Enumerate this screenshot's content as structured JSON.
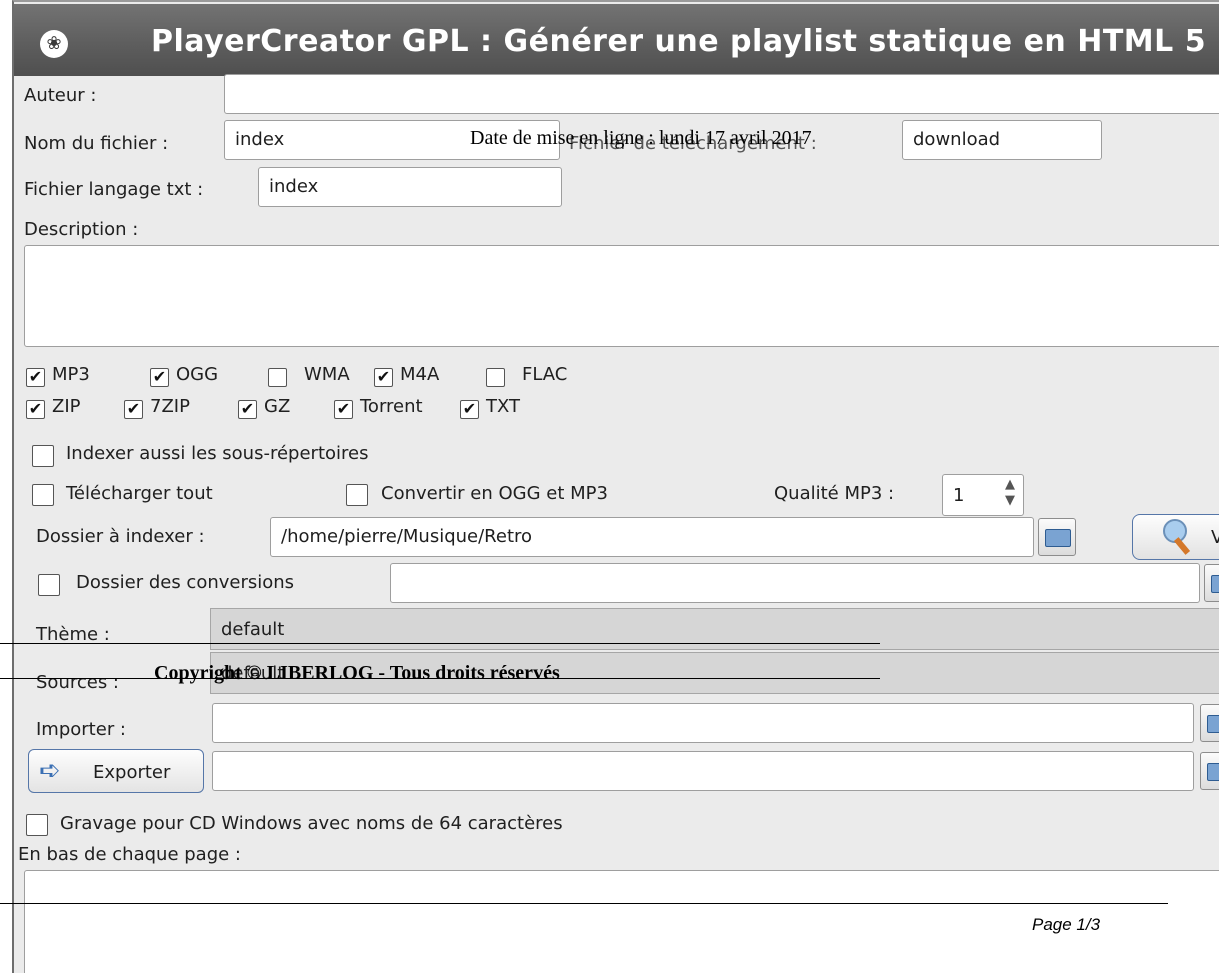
{
  "window": {
    "title": "PlayerCreator GPL  : Générer une playlist statique en HTML 5",
    "icon": "paw-icon"
  },
  "form": {
    "author_label": "Auteur :",
    "author_value": "",
    "filename_label": "Nom du fichier :",
    "filename_value": "index",
    "download_label": "Fichier de téléchargement :",
    "download_value": "download",
    "txt_lang_label": "Fichier langage txt :",
    "txt_lang_value": "index",
    "description_label": "Description :",
    "description_value": ""
  },
  "formats": {
    "row1": [
      {
        "label": "MP3",
        "checked": true
      },
      {
        "label": "OGG",
        "checked": true
      },
      {
        "label": "WMA",
        "checked": false
      },
      {
        "label": "M4A",
        "checked": true
      },
      {
        "label": "FLAC",
        "checked": false
      }
    ],
    "row2": [
      {
        "label": "ZIP",
        "checked": true
      },
      {
        "label": "7ZIP",
        "checked": true
      },
      {
        "label": "GZ",
        "checked": true
      },
      {
        "label": "Torrent",
        "checked": true
      },
      {
        "label": "TXT",
        "checked": true
      }
    ]
  },
  "options": {
    "index_subdirs_label": "Indexer aussi les sous-répertoires",
    "index_subdirs_checked": false,
    "download_all_label": "Télécharger tout",
    "download_all_checked": false,
    "convert_label": "Convertir en OGG et MP3",
    "convert_checked": false,
    "mp3_quality_label": "Qualité MP3 :",
    "mp3_quality_value": "1",
    "folder_label": "Dossier à indexer :",
    "folder_value": "/home/pierre/Musique/Retro",
    "view_button_label": "V",
    "conversions_folder_label": "Dossier des conversions",
    "conversions_folder_checked": false,
    "conversions_folder_value": "",
    "theme_label": "Thème :",
    "theme_value": "default",
    "sources_label": "Sources :",
    "sources_value": "default",
    "import_label": "Importer :",
    "import_value": "",
    "export_button_label": "Exporter",
    "export_value": "",
    "burn_label": "Gravage pour CD Windows avec noms de 64 caractères",
    "burn_checked": false,
    "footer_label": "En bas de chaque page :",
    "footer_value": ""
  },
  "overlay": {
    "date_text": "Date de mise en ligne : lundi 17 avril 2017",
    "copyright_text": "Copyright © LIBERLOG - Tous droits réservés",
    "page_text": "Page 1/3"
  }
}
